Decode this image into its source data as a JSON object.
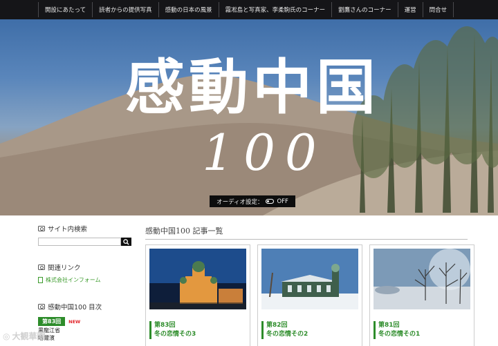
{
  "nav": {
    "items": [
      {
        "label": "開設にあたって"
      },
      {
        "label": "読者からの提供写真"
      },
      {
        "label": "感動の日本の風景"
      },
      {
        "label": "霧凇島と写真家、李柔駒氏のコーナー"
      },
      {
        "label": "劉鷹さんのコーナー"
      },
      {
        "label": "運営"
      },
      {
        "label": "問合せ"
      }
    ]
  },
  "hero": {
    "title_line1": "感動中国",
    "title_line2": "100",
    "audio_label": "オーディオ設定：",
    "audio_state": "OFF"
  },
  "sidebar": {
    "search_heading": "サイト内検索",
    "search_placeholder": "",
    "links_heading": "関連リンク",
    "link_item": "株式会社インフォーム",
    "toc_heading": "感動中国100 目次",
    "toc_episode": "第83回",
    "toc_new": "NEW",
    "toc_sub1": "黒龍江省",
    "toc_sub2": "哈爾濱"
  },
  "main": {
    "title": "感動中国100 記事一覧",
    "cards": [
      {
        "episode": "第83回",
        "title": "冬の恋情その3"
      },
      {
        "episode": "第82回",
        "title": "冬の恋情その2"
      },
      {
        "episode": "第81回",
        "title": "冬の恋情その1"
      }
    ]
  },
  "watermark": {
    "text": "大観華園"
  },
  "colors": {
    "accent_green": "#2d8c2a",
    "new_red": "#e2242a",
    "nav_bg": "#151518"
  }
}
